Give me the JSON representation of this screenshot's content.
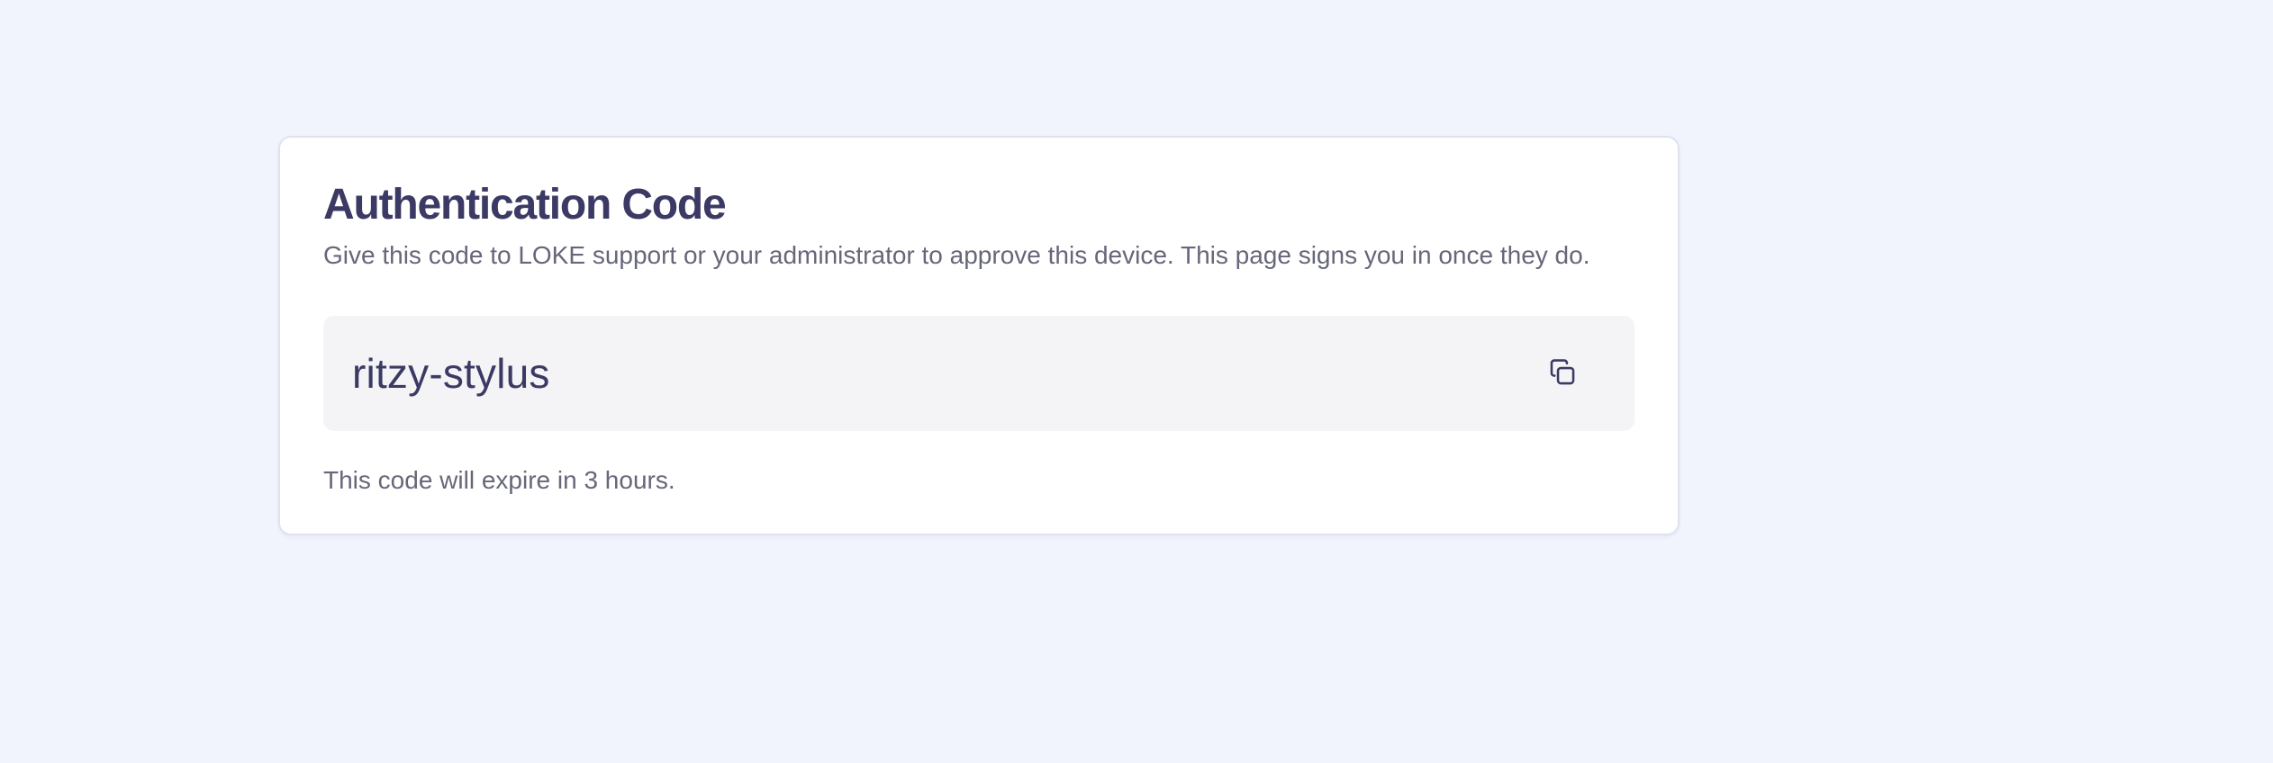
{
  "auth_card": {
    "title": "Authentication Code",
    "description": "Give this code to LOKE support or your administrator to approve this device. This page signs you in once they do.",
    "code": "ritzy-stylus",
    "copy_icon": "copy-icon",
    "expiry_text": "This code will expire in 3 hours."
  },
  "colors": {
    "page_background": "#f1f3fd",
    "card_background": "#ffffff",
    "heading": "#3b3a64",
    "body_text": "#666779",
    "code_box_background": "#f4f4f6"
  }
}
